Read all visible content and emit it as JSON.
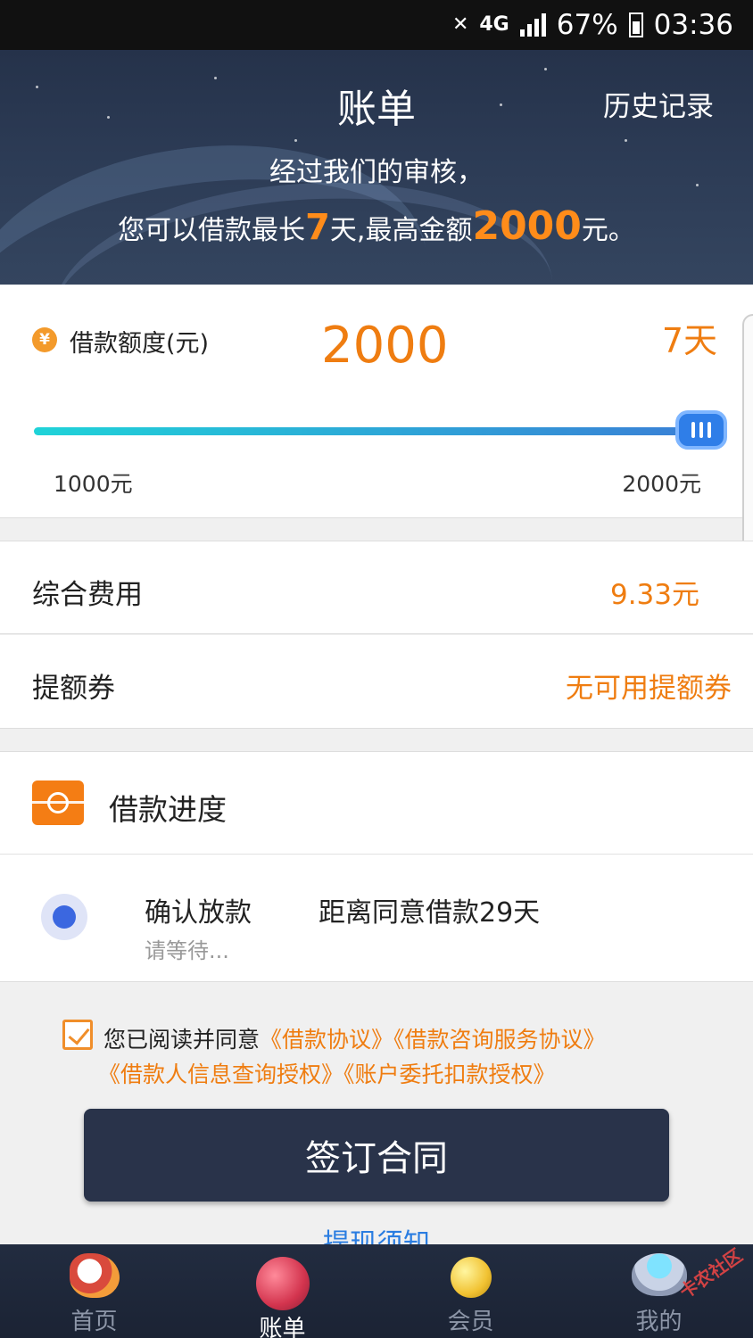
{
  "status_bar": {
    "network": "4G",
    "battery": "67%",
    "time": "03:36"
  },
  "header": {
    "title": "账单",
    "history_link": "历史记录",
    "notice_line1": "经过我们的审核，",
    "notice_prefix": "您可以借款最长",
    "notice_days": "7",
    "notice_mid": "天,最高金额",
    "notice_amount": "2000",
    "notice_suffix": "元。"
  },
  "loan": {
    "currency_icon": "¥",
    "limit_label": "借款额度(元)",
    "amount": "2000",
    "days": "7天",
    "slider_min_label": "1000元",
    "slider_max_label": "2000元",
    "slider_value_fraction": 1.0
  },
  "fees": {
    "label": "综合费用",
    "value": "9.33元"
  },
  "coupon": {
    "label": "提额券",
    "value": "无可用提额券"
  },
  "progress": {
    "title": "借款进度",
    "step_title": "确认放款",
    "step_sub": "请等待...",
    "step_info": "距离同意借款29天"
  },
  "agreement": {
    "checked": true,
    "text": "您已阅读并同意",
    "links": [
      "《借款协议》",
      "《借款咨询服务协议》",
      "《借款人信息查询授权》",
      "《账户委托扣款授权》"
    ]
  },
  "sign_button": "签订合同",
  "withdraw_notice": "提现须知",
  "nav": {
    "items": [
      {
        "label": "首页",
        "icon": "rocket-icon",
        "active": false
      },
      {
        "label": "账单",
        "icon": "planet-icon",
        "active": true
      },
      {
        "label": "会员",
        "icon": "moon-icon",
        "active": false
      },
      {
        "label": "我的",
        "icon": "ufo-icon",
        "active": false
      }
    ]
  },
  "colors": {
    "accent": "#ef7d11",
    "header_bg": "#2c3b55",
    "button_bg": "#29334a",
    "slider_start": "#1fd3d8",
    "slider_end": "#3a7fd6",
    "link_blue": "#2a7de1"
  },
  "watermark": "卡农社区"
}
